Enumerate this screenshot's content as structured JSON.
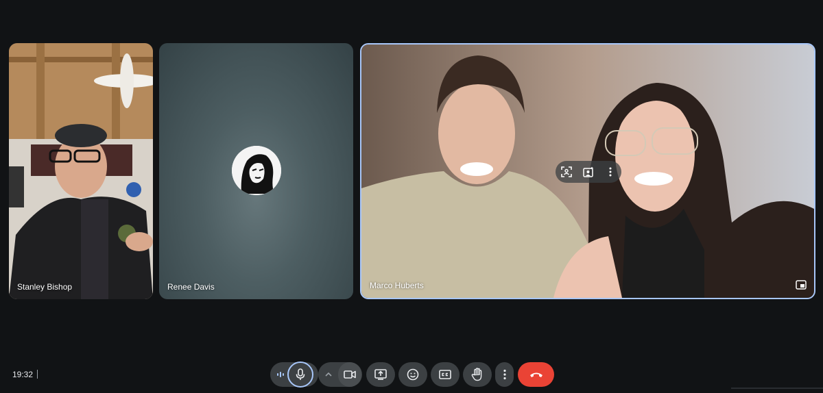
{
  "participants": [
    {
      "name": "Stanley Bishop"
    },
    {
      "name": "Renee Davis"
    },
    {
      "name": "Marco Huberts"
    }
  ],
  "clock": "19:32",
  "icons": {
    "tile_controls": [
      "frame-person-icon",
      "visual-effects-icon",
      "more-vert-icon"
    ],
    "pip": "picture-in-picture-icon",
    "toolbar": [
      "audio-level-icon",
      "microphone-icon",
      "chevron-up-icon",
      "camera-icon",
      "present-screen-icon",
      "emoji-icon",
      "captions-icon",
      "raise-hand-icon",
      "more-vert-icon",
      "end-call-icon"
    ]
  },
  "colors": {
    "background": "#111315",
    "button": "#3c4043",
    "end_call": "#ea4335",
    "active_outline": "#a8c7fa"
  }
}
